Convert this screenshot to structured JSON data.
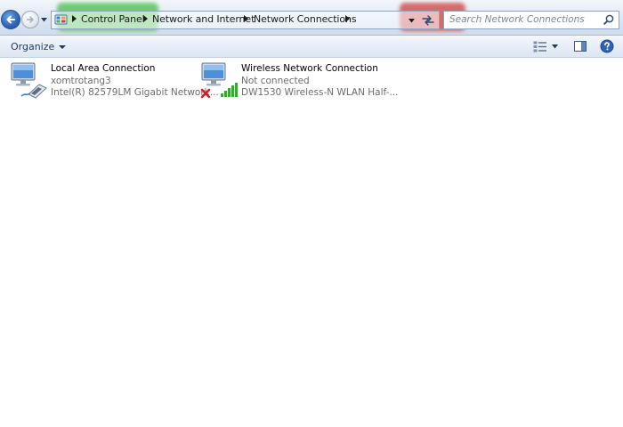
{
  "address_bar": {
    "breadcrumbs": [
      "Control Panel",
      "Network and Internet",
      "Network Connections"
    ]
  },
  "search": {
    "placeholder": "Search Network Connections"
  },
  "command_bar": {
    "organize_label": "Organize"
  },
  "connections": [
    {
      "name": "Local Area Connection",
      "status": "xomtrotang3",
      "device": "Intel(R) 82579LM Gigabit Network...",
      "icon": "wired-network-adapter-icon"
    },
    {
      "name": "Wireless Network Connection",
      "status": "Not connected",
      "device": "DW1530 Wireless-N WLAN Half-...",
      "icon": "wireless-network-adapter-icon"
    }
  ],
  "colors": {
    "highlight_breadcrumb": "#5cc45c",
    "highlight_refresh": "#d05454",
    "command_text": "#1e395b",
    "disconnected_x": "#d81e1e",
    "signal_bars": "#3aa635"
  }
}
